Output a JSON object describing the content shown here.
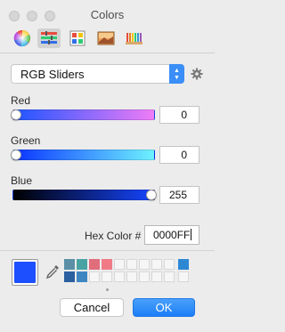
{
  "window": {
    "title": "Colors"
  },
  "tabs": [
    {
      "name": "color-wheel",
      "selected": false
    },
    {
      "name": "color-sliders",
      "selected": true
    },
    {
      "name": "color-palettes",
      "selected": false
    },
    {
      "name": "image-palettes",
      "selected": false
    },
    {
      "name": "pencils",
      "selected": false
    }
  ],
  "mode": {
    "selected": "RGB Sliders"
  },
  "sliders": [
    {
      "label": "Red",
      "value": "0",
      "fraction": 0.0,
      "gradient": [
        "#1d55ff",
        "#f07cf7"
      ]
    },
    {
      "label": "Green",
      "value": "0",
      "fraction": 0.0,
      "gradient": [
        "#0a33ff",
        "#6ef2ff"
      ]
    },
    {
      "label": "Blue",
      "value": "255",
      "fraction": 1.0,
      "gradient": [
        "#000000",
        "#1645ff"
      ]
    }
  ],
  "hex": {
    "label": "Hex Color #",
    "value": "0000FF"
  },
  "current_color": "#1d4fff",
  "swatches": {
    "row1": [
      "#5a8fa6",
      "#4aa3a3",
      "#e06e7a",
      "#f07a86",
      "",
      "",
      "",
      "",
      "",
      "#2d88d4"
    ],
    "row2": [
      "#2a5fa0",
      "#3d86c2",
      "",
      "",
      "",
      "",
      "",
      "",
      "",
      ""
    ]
  },
  "buttons": {
    "cancel": "Cancel",
    "ok": "OK"
  }
}
